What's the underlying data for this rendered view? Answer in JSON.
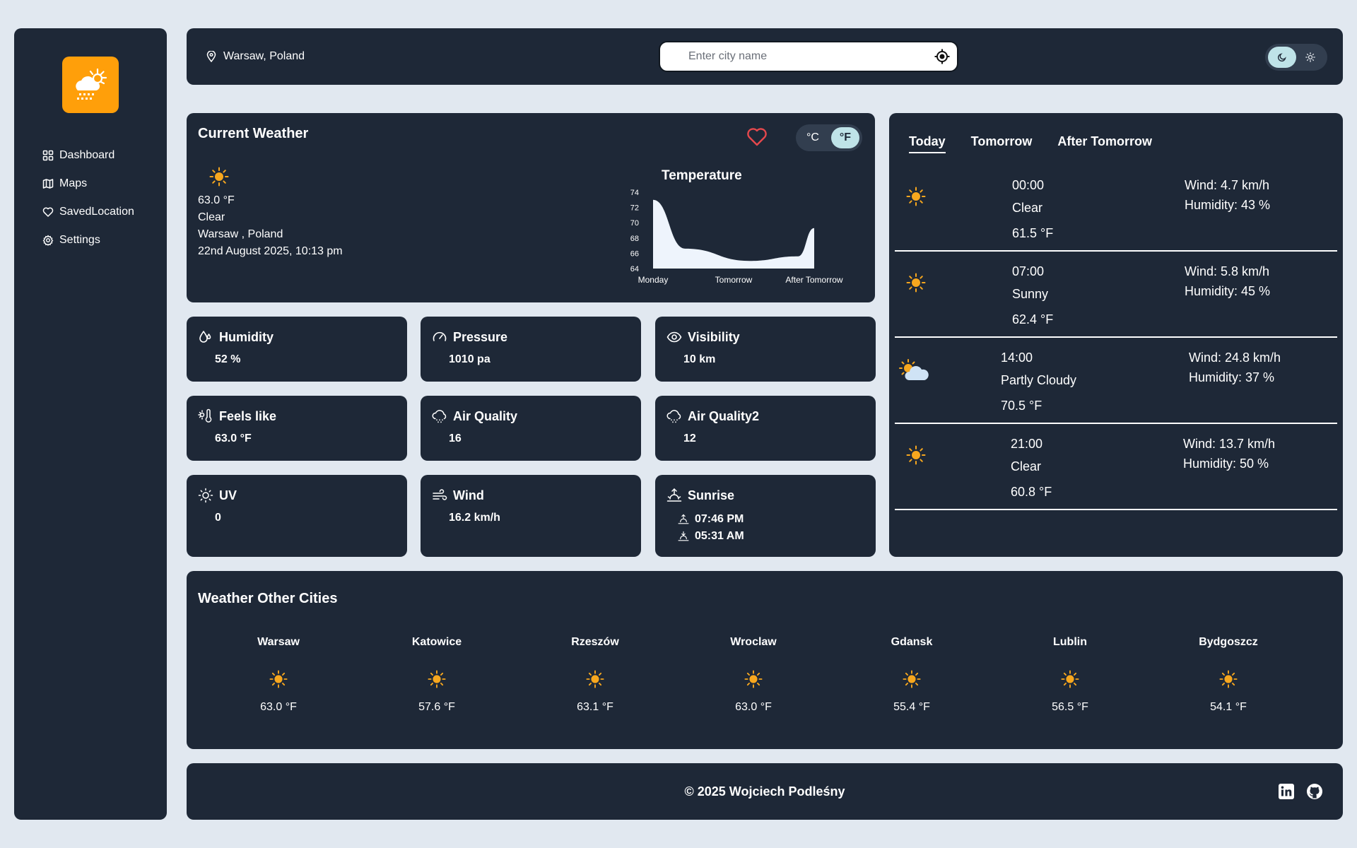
{
  "app": {
    "logo_icon": "cloud-sun-rain-icon",
    "accent": "#ff9f0a"
  },
  "sidebar": {
    "items": [
      {
        "label": "Dashboard",
        "icon": "grid-icon"
      },
      {
        "label": "Maps",
        "icon": "map-icon"
      },
      {
        "label": "SavedLocation",
        "icon": "heart-icon"
      },
      {
        "label": "Settings",
        "icon": "gear-icon"
      }
    ]
  },
  "header": {
    "location": "Warsaw, Poland",
    "search_placeholder": "Enter city name",
    "theme_active": "dark"
  },
  "current": {
    "title": "Current Weather",
    "temp": "63.0 °F",
    "condition": "Clear",
    "place": "Warsaw , Poland",
    "datetime": "22nd August 2025, 10:13 pm",
    "unit_c": "°C",
    "unit_f": "°F",
    "unit_active": "F"
  },
  "chart_data": {
    "type": "area",
    "title": "Temperature",
    "categories": [
      "Monday",
      "Tomorrow",
      "After Tomorrow"
    ],
    "x": [
      0,
      0.4,
      1.2,
      1.8,
      2.0
    ],
    "values": [
      73.0,
      66.6,
      65.0,
      65.6,
      69.3
    ],
    "yticks": [
      64,
      66,
      68,
      70,
      72,
      74
    ],
    "ylim": [
      64,
      74
    ],
    "fill": "#eef4fc"
  },
  "stats": {
    "humidity": {
      "label": "Humidity",
      "value": "52 %"
    },
    "pressure": {
      "label": "Pressure",
      "value": "1010 pa"
    },
    "visibility": {
      "label": "Visibility",
      "value": "10 km"
    },
    "feels_like": {
      "label": "Feels like",
      "value": "63.0 °F"
    },
    "air_quality": {
      "label": "Air Quality",
      "value": "16"
    },
    "air_quality2": {
      "label": "Air Quality2",
      "value": "12"
    },
    "uv": {
      "label": "UV",
      "value": "0"
    },
    "wind": {
      "label": "Wind",
      "value": "16.2 km/h"
    },
    "sunrise": {
      "label": "Sunrise",
      "sunrise": "07:46 PM",
      "sunset": "05:31 AM"
    }
  },
  "forecast": {
    "tabs": [
      "Today",
      "Tomorrow",
      "After Tomorrow"
    ],
    "active_tab": "Today",
    "entries": [
      {
        "time": "00:00",
        "condition": "Clear",
        "temp": "61.5 °F",
        "wind": "Wind: 4.7 km/h",
        "humidity": "Humidity: 43 %",
        "icon": "sun-icon"
      },
      {
        "time": "07:00",
        "condition": "Sunny",
        "temp": "62.4 °F",
        "wind": "Wind: 5.8 km/h",
        "humidity": "Humidity: 45 %",
        "icon": "sun-icon"
      },
      {
        "time": "14:00",
        "condition": "Partly Cloudy",
        "temp": "70.5 °F",
        "wind": "Wind: 24.8 km/h",
        "humidity": "Humidity: 37 %",
        "icon": "partly-cloudy-icon"
      },
      {
        "time": "21:00",
        "condition": "Clear",
        "temp": "60.8 °F",
        "wind": "Wind: 13.7 km/h",
        "humidity": "Humidity: 50 %",
        "icon": "sun-icon"
      }
    ]
  },
  "cities": {
    "title": "Weather Other Cities",
    "items": [
      {
        "name": "Warsaw",
        "temp": "63.0 °F"
      },
      {
        "name": "Katowice",
        "temp": "57.6 °F"
      },
      {
        "name": "Rzeszów",
        "temp": "63.1 °F"
      },
      {
        "name": "Wroclaw",
        "temp": "63.0 °F"
      },
      {
        "name": "Gdansk",
        "temp": "55.4 °F"
      },
      {
        "name": "Lublin",
        "temp": "56.5 °F"
      },
      {
        "name": "Bydgoszcz",
        "temp": "54.1 °F"
      }
    ]
  },
  "footer": {
    "copyright": "© 2025 Wojciech Podleśny",
    "links": [
      "linkedin-icon",
      "github-icon"
    ]
  }
}
